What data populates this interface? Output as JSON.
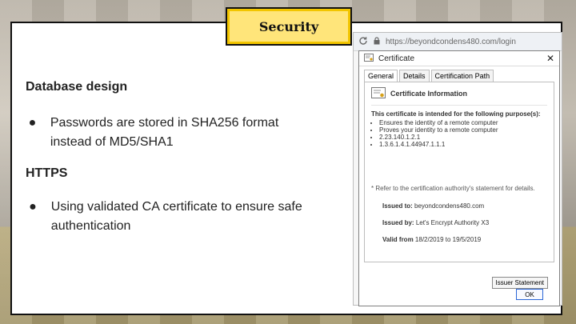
{
  "slide": {
    "title": "Security",
    "section1_heading": "Database design",
    "section1_bullet": "Passwords are stored in SHA256 format instead of MD5/SHA1",
    "section2_heading": "HTTPS",
    "section2_bullet": "Using validated CA certificate to ensure safe authentication",
    "bullet_glyph": "●"
  },
  "browser": {
    "url": "https://beyondcondens480.com/login"
  },
  "certificate": {
    "window_title": "Certificate",
    "close_glyph": "✕",
    "tabs": [
      "General",
      "Details",
      "Certification Path"
    ],
    "info_title": "Certificate Information",
    "purpose_heading": "This certificate is intended for the following purpose(s):",
    "purposes": [
      "Ensures the identity of a remote computer",
      "Proves your identity to a remote computer",
      "2.23.140.1.2.1",
      "1.3.6.1.4.1.44947.1.1.1"
    ],
    "note": "* Refer to the certification authority's statement for details.",
    "issued_to_label": "Issued to:",
    "issued_to_value": "beyondcondens480.com",
    "issued_by_label": "Issued by:",
    "issued_by_value": "Let's Encrypt Authority X3",
    "valid_from_label": "Valid from",
    "valid_from_value": "18/2/2019 to 19/5/2019",
    "issuer_statement_label": "Issuer Statement",
    "ok_label": "OK"
  },
  "colors": {
    "title_fill": "#ffe57a",
    "title_border": "#f2c500",
    "ok_border": "#2b66d6"
  }
}
